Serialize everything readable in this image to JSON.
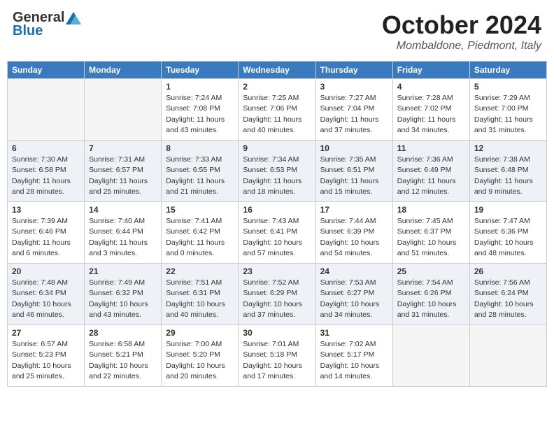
{
  "header": {
    "logo_general": "General",
    "logo_blue": "Blue",
    "month": "October 2024",
    "location": "Mombaldone, Piedmont, Italy"
  },
  "days_of_week": [
    "Sunday",
    "Monday",
    "Tuesday",
    "Wednesday",
    "Thursday",
    "Friday",
    "Saturday"
  ],
  "weeks": [
    [
      {
        "day": "",
        "sunrise": "",
        "sunset": "",
        "daylight": "",
        "empty": true
      },
      {
        "day": "",
        "sunrise": "",
        "sunset": "",
        "daylight": "",
        "empty": true
      },
      {
        "day": "1",
        "sunrise": "Sunrise: 7:24 AM",
        "sunset": "Sunset: 7:08 PM",
        "daylight": "Daylight: 11 hours and 43 minutes."
      },
      {
        "day": "2",
        "sunrise": "Sunrise: 7:25 AM",
        "sunset": "Sunset: 7:06 PM",
        "daylight": "Daylight: 11 hours and 40 minutes."
      },
      {
        "day": "3",
        "sunrise": "Sunrise: 7:27 AM",
        "sunset": "Sunset: 7:04 PM",
        "daylight": "Daylight: 11 hours and 37 minutes."
      },
      {
        "day": "4",
        "sunrise": "Sunrise: 7:28 AM",
        "sunset": "Sunset: 7:02 PM",
        "daylight": "Daylight: 11 hours and 34 minutes."
      },
      {
        "day": "5",
        "sunrise": "Sunrise: 7:29 AM",
        "sunset": "Sunset: 7:00 PM",
        "daylight": "Daylight: 11 hours and 31 minutes."
      }
    ],
    [
      {
        "day": "6",
        "sunrise": "Sunrise: 7:30 AM",
        "sunset": "Sunset: 6:58 PM",
        "daylight": "Daylight: 11 hours and 28 minutes."
      },
      {
        "day": "7",
        "sunrise": "Sunrise: 7:31 AM",
        "sunset": "Sunset: 6:57 PM",
        "daylight": "Daylight: 11 hours and 25 minutes."
      },
      {
        "day": "8",
        "sunrise": "Sunrise: 7:33 AM",
        "sunset": "Sunset: 6:55 PM",
        "daylight": "Daylight: 11 hours and 21 minutes."
      },
      {
        "day": "9",
        "sunrise": "Sunrise: 7:34 AM",
        "sunset": "Sunset: 6:53 PM",
        "daylight": "Daylight: 11 hours and 18 minutes."
      },
      {
        "day": "10",
        "sunrise": "Sunrise: 7:35 AM",
        "sunset": "Sunset: 6:51 PM",
        "daylight": "Daylight: 11 hours and 15 minutes."
      },
      {
        "day": "11",
        "sunrise": "Sunrise: 7:36 AM",
        "sunset": "Sunset: 6:49 PM",
        "daylight": "Daylight: 11 hours and 12 minutes."
      },
      {
        "day": "12",
        "sunrise": "Sunrise: 7:38 AM",
        "sunset": "Sunset: 6:48 PM",
        "daylight": "Daylight: 11 hours and 9 minutes."
      }
    ],
    [
      {
        "day": "13",
        "sunrise": "Sunrise: 7:39 AM",
        "sunset": "Sunset: 6:46 PM",
        "daylight": "Daylight: 11 hours and 6 minutes."
      },
      {
        "day": "14",
        "sunrise": "Sunrise: 7:40 AM",
        "sunset": "Sunset: 6:44 PM",
        "daylight": "Daylight: 11 hours and 3 minutes."
      },
      {
        "day": "15",
        "sunrise": "Sunrise: 7:41 AM",
        "sunset": "Sunset: 6:42 PM",
        "daylight": "Daylight: 11 hours and 0 minutes."
      },
      {
        "day": "16",
        "sunrise": "Sunrise: 7:43 AM",
        "sunset": "Sunset: 6:41 PM",
        "daylight": "Daylight: 10 hours and 57 minutes."
      },
      {
        "day": "17",
        "sunrise": "Sunrise: 7:44 AM",
        "sunset": "Sunset: 6:39 PM",
        "daylight": "Daylight: 10 hours and 54 minutes."
      },
      {
        "day": "18",
        "sunrise": "Sunrise: 7:45 AM",
        "sunset": "Sunset: 6:37 PM",
        "daylight": "Daylight: 10 hours and 51 minutes."
      },
      {
        "day": "19",
        "sunrise": "Sunrise: 7:47 AM",
        "sunset": "Sunset: 6:36 PM",
        "daylight": "Daylight: 10 hours and 48 minutes."
      }
    ],
    [
      {
        "day": "20",
        "sunrise": "Sunrise: 7:48 AM",
        "sunset": "Sunset: 6:34 PM",
        "daylight": "Daylight: 10 hours and 46 minutes."
      },
      {
        "day": "21",
        "sunrise": "Sunrise: 7:49 AM",
        "sunset": "Sunset: 6:32 PM",
        "daylight": "Daylight: 10 hours and 43 minutes."
      },
      {
        "day": "22",
        "sunrise": "Sunrise: 7:51 AM",
        "sunset": "Sunset: 6:31 PM",
        "daylight": "Daylight: 10 hours and 40 minutes."
      },
      {
        "day": "23",
        "sunrise": "Sunrise: 7:52 AM",
        "sunset": "Sunset: 6:29 PM",
        "daylight": "Daylight: 10 hours and 37 minutes."
      },
      {
        "day": "24",
        "sunrise": "Sunrise: 7:53 AM",
        "sunset": "Sunset: 6:27 PM",
        "daylight": "Daylight: 10 hours and 34 minutes."
      },
      {
        "day": "25",
        "sunrise": "Sunrise: 7:54 AM",
        "sunset": "Sunset: 6:26 PM",
        "daylight": "Daylight: 10 hours and 31 minutes."
      },
      {
        "day": "26",
        "sunrise": "Sunrise: 7:56 AM",
        "sunset": "Sunset: 6:24 PM",
        "daylight": "Daylight: 10 hours and 28 minutes."
      }
    ],
    [
      {
        "day": "27",
        "sunrise": "Sunrise: 6:57 AM",
        "sunset": "Sunset: 5:23 PM",
        "daylight": "Daylight: 10 hours and 25 minutes."
      },
      {
        "day": "28",
        "sunrise": "Sunrise: 6:58 AM",
        "sunset": "Sunset: 5:21 PM",
        "daylight": "Daylight: 10 hours and 22 minutes."
      },
      {
        "day": "29",
        "sunrise": "Sunrise: 7:00 AM",
        "sunset": "Sunset: 5:20 PM",
        "daylight": "Daylight: 10 hours and 20 minutes."
      },
      {
        "day": "30",
        "sunrise": "Sunrise: 7:01 AM",
        "sunset": "Sunset: 5:18 PM",
        "daylight": "Daylight: 10 hours and 17 minutes."
      },
      {
        "day": "31",
        "sunrise": "Sunrise: 7:02 AM",
        "sunset": "Sunset: 5:17 PM",
        "daylight": "Daylight: 10 hours and 14 minutes."
      },
      {
        "day": "",
        "sunrise": "",
        "sunset": "",
        "daylight": "",
        "empty": true
      },
      {
        "day": "",
        "sunrise": "",
        "sunset": "",
        "daylight": "",
        "empty": true
      }
    ]
  ]
}
